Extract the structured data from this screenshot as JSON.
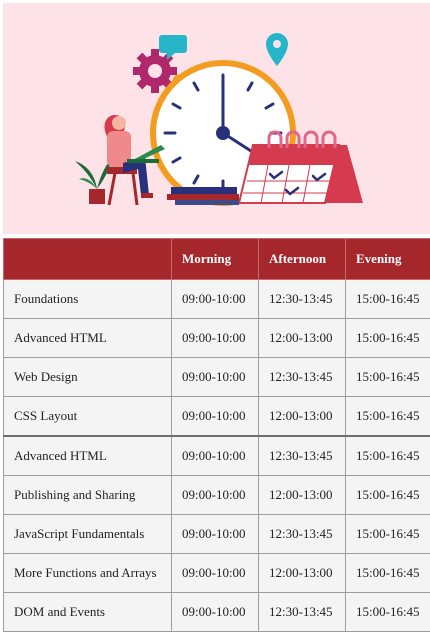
{
  "colors": {
    "header_bg": "#a5262b",
    "header_text": "#ffffff",
    "row_bg": "#f4f4f4",
    "hero_bg": "#fde3e7",
    "clock_ring": "#f39c1f",
    "calendar": "#d63a4f",
    "gear": "#b0276b",
    "pin": "#27b6c9"
  },
  "hero": {
    "icons": [
      "gear-icon",
      "chat-bubble-icon",
      "location-pin-icon",
      "clock-icon",
      "calendar-icon",
      "person-with-laptop",
      "plant-icon",
      "books-icon"
    ]
  },
  "table": {
    "headers": [
      "",
      "Morning",
      "Afternoon",
      "Evening"
    ],
    "rows": [
      [
        "Foundations",
        "09:00-10:00",
        "12:30-13:45",
        "15:00-16:45"
      ],
      [
        "Advanced HTML",
        "09:00-10:00",
        "12:00-13:00",
        "15:00-16:45"
      ],
      [
        "Web Design",
        "09:00-10:00",
        "12:30-13:45",
        "15:00-16:45"
      ],
      [
        "CSS Layout",
        "09:00-10:00",
        "12:00-13:00",
        "15:00-16:45"
      ],
      [
        "Advanced HTML",
        "09:00-10:00",
        "12:30-13:45",
        "15:00-16:45"
      ],
      [
        "Publishing and Sharing",
        "09:00-10:00",
        "12:00-13:00",
        "15:00-16:45"
      ],
      [
        "JavaScript Fundamentals",
        "09:00-10:00",
        "12:30-13:45",
        "15:00-16:45"
      ],
      [
        "More Functions and Arrays",
        "09:00-10:00",
        "12:00-13:00",
        "15:00-16:45"
      ],
      [
        "DOM and Events",
        "09:00-10:00",
        "12:30-13:45",
        "15:00-16:45"
      ]
    ]
  }
}
